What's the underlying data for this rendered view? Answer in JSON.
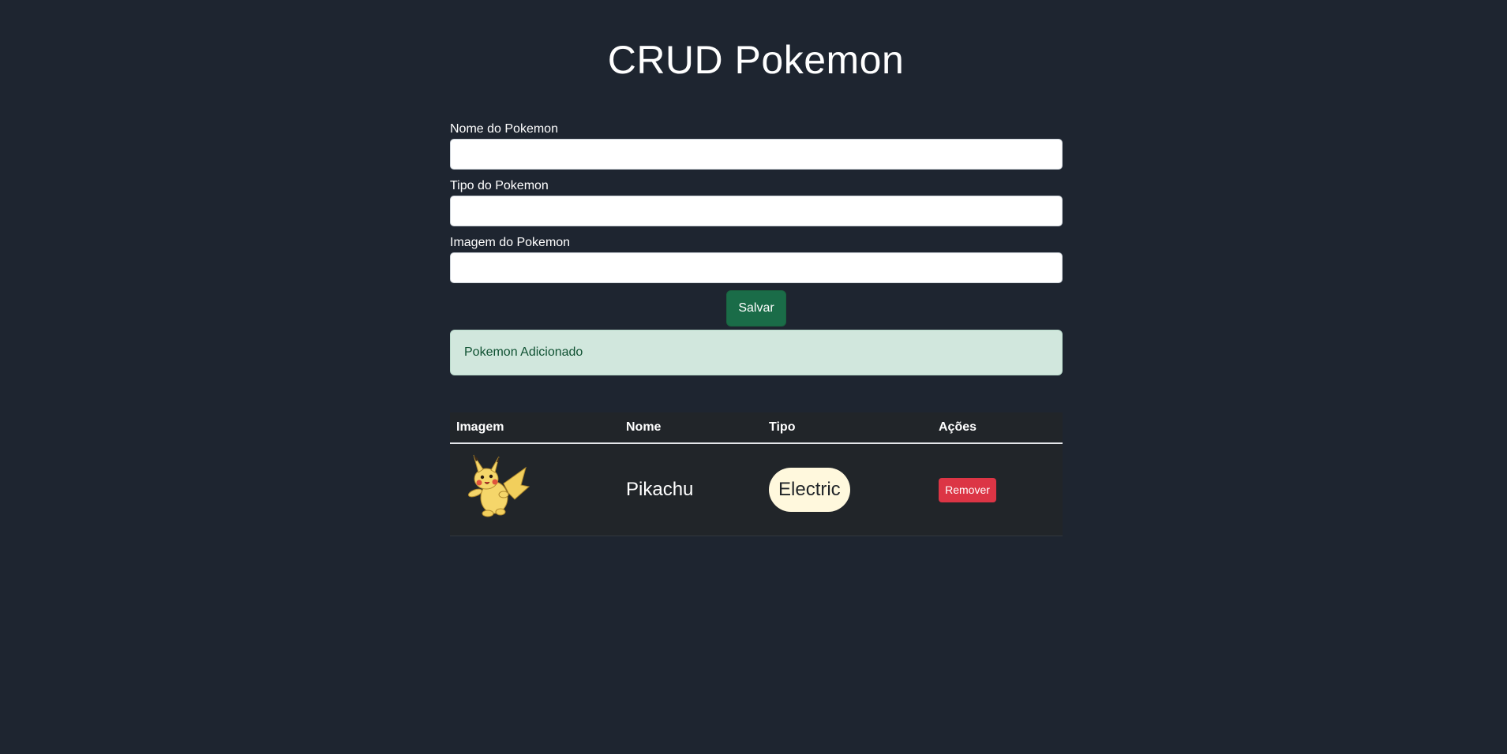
{
  "header": {
    "title": "CRUD Pokemon"
  },
  "form": {
    "name_label": "Nome do Pokemon",
    "name_value": "",
    "type_label": "Tipo do Pokemon",
    "type_value": "",
    "image_label": "Imagem do Pokemon",
    "image_value": "",
    "save_label": "Salvar"
  },
  "alert": {
    "message": "Pokemon Adicionado",
    "color": "#d1e7dd"
  },
  "table": {
    "columns": [
      "Imagem",
      "Nome",
      "Tipo",
      "Ações"
    ],
    "rows": [
      {
        "image_icon": "pikachu-image",
        "name": "Pikachu",
        "type": "Electric",
        "action_label": "Remover"
      }
    ]
  },
  "colors": {
    "background": "#1e2530",
    "save_button": "#1a6c48",
    "remove_button": "#dc3545",
    "type_badge": "#fff8dd"
  }
}
